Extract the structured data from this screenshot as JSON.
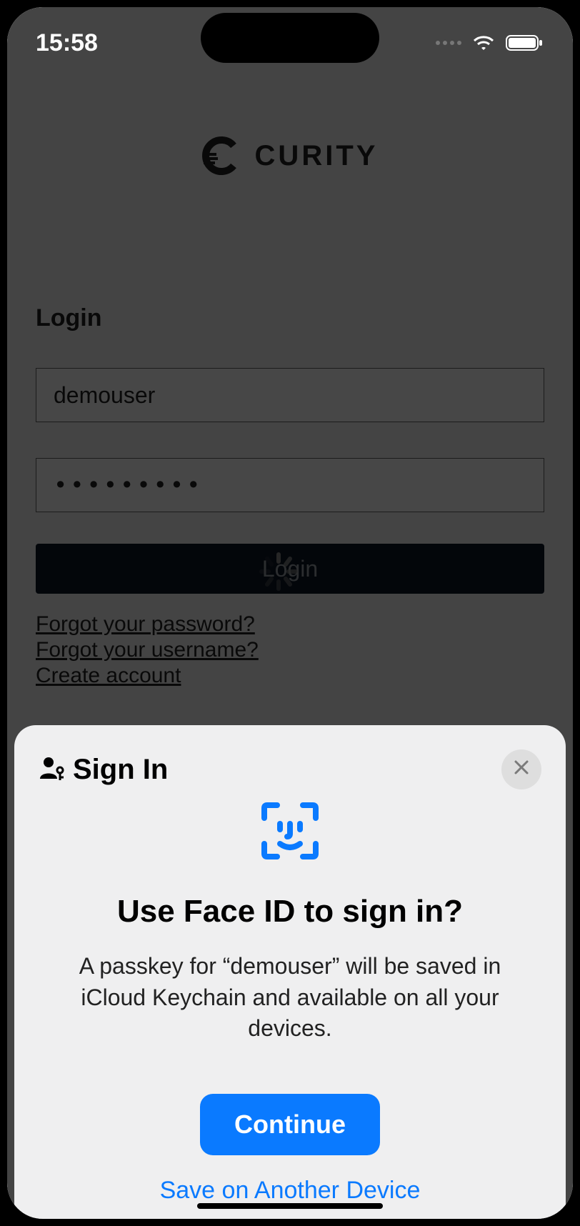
{
  "status": {
    "time": "15:58"
  },
  "brand": {
    "name": "CURITY"
  },
  "login": {
    "heading": "Login",
    "username": "demouser",
    "password": "•••••••••",
    "button": "Login",
    "forgot_password": "Forgot your password?",
    "forgot_username": "Forgot your username?",
    "create_account": "Create account"
  },
  "sheet": {
    "title": "Sign In",
    "heading": "Use Face ID to sign in?",
    "body": "A passkey for “demouser” will be saved in iCloud Keychain and available on all your devices.",
    "continue": "Continue",
    "save_other": "Save on Another Device"
  }
}
